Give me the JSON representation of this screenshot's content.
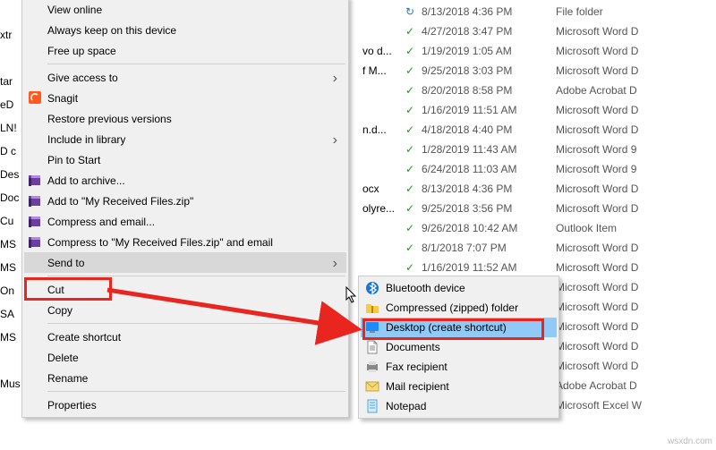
{
  "watermark": "wsxdn.com",
  "file_rows": [
    {
      "fragment": "",
      "status": "sync",
      "date": "8/13/2018 4:36 PM",
      "type": "File folder"
    },
    {
      "fragment": "",
      "status": "check",
      "date": "4/27/2018 3:47 PM",
      "type": "Microsoft Word D"
    },
    {
      "fragment": "vo d...",
      "status": "check",
      "date": "1/19/2019 1:05 AM",
      "type": "Microsoft Word D"
    },
    {
      "fragment": "f M...",
      "status": "check",
      "date": "9/25/2018 3:03 PM",
      "type": "Microsoft Word D"
    },
    {
      "fragment": "",
      "status": "check",
      "date": "8/20/2018 8:58 PM",
      "type": "Adobe Acrobat D"
    },
    {
      "fragment": "",
      "status": "check",
      "date": "1/16/2019 11:51 AM",
      "type": "Microsoft Word D"
    },
    {
      "fragment": "n.d...",
      "status": "check",
      "date": "4/18/2018 4:40 PM",
      "type": "Microsoft Word D"
    },
    {
      "fragment": "",
      "status": "check",
      "date": "1/28/2019 11:43 AM",
      "type": "Microsoft Word 9"
    },
    {
      "fragment": "",
      "status": "check",
      "date": "6/24/2018 11:03 AM",
      "type": "Microsoft Word 9"
    },
    {
      "fragment": "ocx",
      "status": "check",
      "date": "8/13/2018 4:36 PM",
      "type": "Microsoft Word D"
    },
    {
      "fragment": "olyre...",
      "status": "check",
      "date": "9/25/2018 3:56 PM",
      "type": "Microsoft Word D"
    },
    {
      "fragment": "",
      "status": "check",
      "date": "9/26/2018 10:42 AM",
      "type": "Outlook Item"
    },
    {
      "fragment": "",
      "status": "check",
      "date": "8/1/2018 7:07 PM",
      "type": "Microsoft Word D"
    },
    {
      "fragment": "",
      "status": "check",
      "date": "1/16/2019 11:52 AM",
      "type": "Microsoft Word D"
    },
    {
      "fragment": "",
      "status": "check",
      "date": "",
      "type": "Microsoft Word D"
    },
    {
      "fragment": "",
      "status": "check",
      "date": "",
      "type": "Microsoft Word D"
    },
    {
      "fragment": "",
      "status": "check",
      "date": "",
      "type": "Microsoft Word D"
    },
    {
      "fragment": "",
      "status": "check",
      "date": "",
      "type": "Microsoft Word D"
    },
    {
      "fragment": "",
      "status": "check",
      "date": "",
      "type": "Microsoft Word D"
    },
    {
      "fragment": "",
      "status": "check",
      "date": "",
      "type": "Adobe Acrobat D"
    },
    {
      "fragment": "",
      "status": "check",
      "date": "",
      "type": "Microsoft Excel W"
    }
  ],
  "folder_labels_left": [
    "",
    "xtr",
    "",
    "tar",
    "eD",
    "LN!",
    "D c",
    "Des",
    "Doc",
    "Cu",
    "MS",
    "MS",
    "On",
    "SA",
    "MS",
    "",
    "Mus",
    "",
    ""
  ],
  "context_menu": {
    "groups": [
      [
        {
          "label": "View online",
          "icon": null,
          "chev": false
        },
        {
          "label": "Always keep on this device",
          "icon": null,
          "chev": false
        },
        {
          "label": "Free up space",
          "icon": null,
          "chev": false
        }
      ],
      [
        {
          "label": "Give access to",
          "icon": null,
          "chev": true
        },
        {
          "label": "Snagit",
          "icon": "snagit",
          "chev": false
        },
        {
          "label": "Restore previous versions",
          "icon": null,
          "chev": false
        },
        {
          "label": "Include in library",
          "icon": null,
          "chev": true
        },
        {
          "label": "Pin to Start",
          "icon": null,
          "chev": false
        },
        {
          "label": "Add to archive...",
          "icon": "winrar",
          "chev": false
        },
        {
          "label": "Add to \"My Received Files.zip\"",
          "icon": "winrar",
          "chev": false
        },
        {
          "label": "Compress and email...",
          "icon": "winrar",
          "chev": false
        },
        {
          "label": "Compress to \"My Received Files.zip\" and email",
          "icon": "winrar",
          "chev": false
        },
        {
          "label": "Send to",
          "icon": null,
          "chev": true,
          "highlight": true
        }
      ],
      [
        {
          "label": "Cut",
          "icon": null,
          "chev": false
        },
        {
          "label": "Copy",
          "icon": null,
          "chev": false
        }
      ],
      [
        {
          "label": "Create shortcut",
          "icon": null,
          "chev": false
        },
        {
          "label": "Delete",
          "icon": null,
          "chev": false
        },
        {
          "label": "Rename",
          "icon": null,
          "chev": false
        }
      ],
      [
        {
          "label": "Properties",
          "icon": null,
          "chev": false
        }
      ]
    ]
  },
  "submenu": {
    "items": [
      {
        "label": "Bluetooth device",
        "icon": "bluetooth"
      },
      {
        "label": "Compressed (zipped) folder",
        "icon": "zip"
      },
      {
        "label": "Desktop (create shortcut)",
        "icon": "desktop",
        "highlight": true
      },
      {
        "label": "Documents",
        "icon": "documents"
      },
      {
        "label": "Fax recipient",
        "icon": "fax"
      },
      {
        "label": "Mail recipient",
        "icon": "mail"
      },
      {
        "label": "Notepad",
        "icon": "notepad"
      }
    ]
  }
}
